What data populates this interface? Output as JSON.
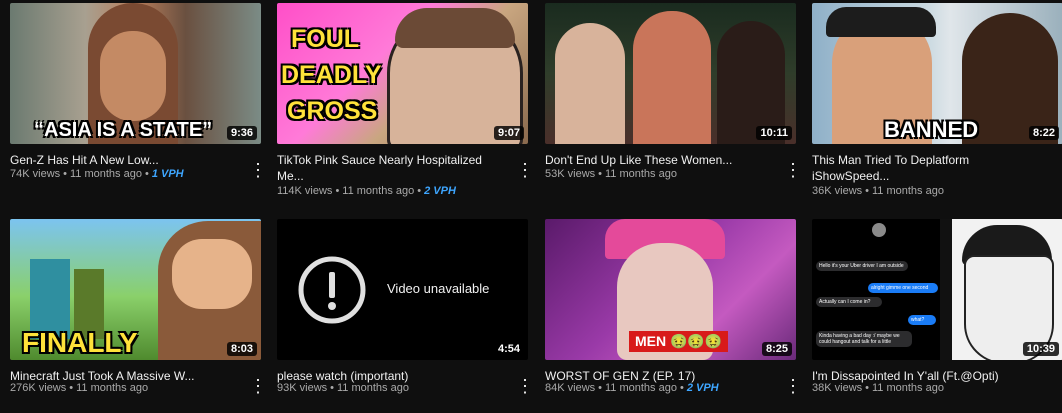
{
  "videos": [
    {
      "title": "Gen-Z Has Hit A New Low...",
      "views": "74K views",
      "age": "11 months ago",
      "vph": "1 VPH",
      "duration": "9:36",
      "overlay": "“ASIA IS A STATE”"
    },
    {
      "title": "TikTok Pink Sauce Nearly Hospitalized Me...",
      "views": "114K views",
      "age": "11 months ago",
      "vph": "2 VPH",
      "duration": "9:07",
      "overlay_lines": [
        "FOUL",
        "DEADLY",
        "GROSS"
      ]
    },
    {
      "title": "Don't End Up Like These Women...",
      "views": "53K views",
      "age": "11 months ago",
      "duration": "10:11"
    },
    {
      "title": "This Man Tried To Deplatform iShowSpeed...",
      "views": "36K views",
      "age": "11 months ago",
      "duration": "8:22",
      "overlay": "BANNED"
    },
    {
      "title": "Minecraft Just Took A Massive W...",
      "views": "276K views",
      "age": "11 months ago",
      "duration": "8:03",
      "overlay": "FINALLY"
    },
    {
      "title": "please watch (important)",
      "views": "93K views",
      "age": "11 months ago",
      "duration": "4:54",
      "unavailable": "Video unavailable"
    },
    {
      "title": "WORST OF GEN Z (EP. 17)",
      "views": "84K views",
      "age": "11 months ago",
      "vph": "2 VPH",
      "duration": "8:25",
      "overlay": "MEN 🤢🤢🤢"
    },
    {
      "title": "I'm Dissapointed In Y'all (Ft.@Opti)",
      "views": "38K views",
      "age": "11 months ago",
      "duration": "10:39",
      "chat": [
        "Hello it's your Uber driver I am outside",
        "alright gimme one second",
        "Actually can I come in?",
        "what?",
        "Kinda having a bad day :/ maybe we could hangout and talk for a little"
      ]
    }
  ],
  "meta_separator": "•",
  "menu_glyph": "⋮",
  "colors": {
    "background": "#0f0f0f",
    "vph": "#3ea6ff",
    "meta": "#aaaaaa"
  }
}
